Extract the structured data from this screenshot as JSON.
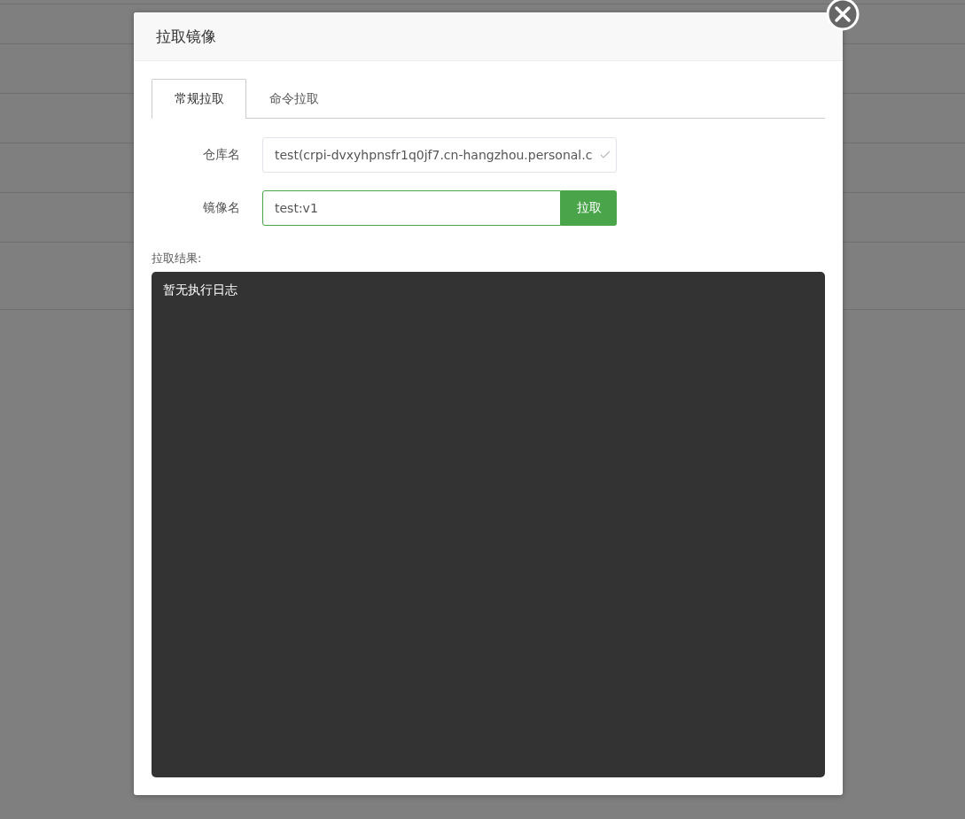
{
  "dialog": {
    "title": "拉取镜像",
    "tabs": [
      {
        "label": "常规拉取",
        "selected": true
      },
      {
        "label": "命令拉取",
        "selected": false
      }
    ],
    "form": [
      {
        "kind": "select",
        "label": "仓库名",
        "value": "test(crpi-dvxyhpnsfr1q0jf7.cn-hangzhou.personal.c"
      },
      {
        "kind": "input",
        "label": "镜像名",
        "value": "test:v1",
        "button": "拉取"
      }
    ],
    "result": {
      "label": "拉取结果:",
      "log": "暂无执行日志"
    }
  }
}
